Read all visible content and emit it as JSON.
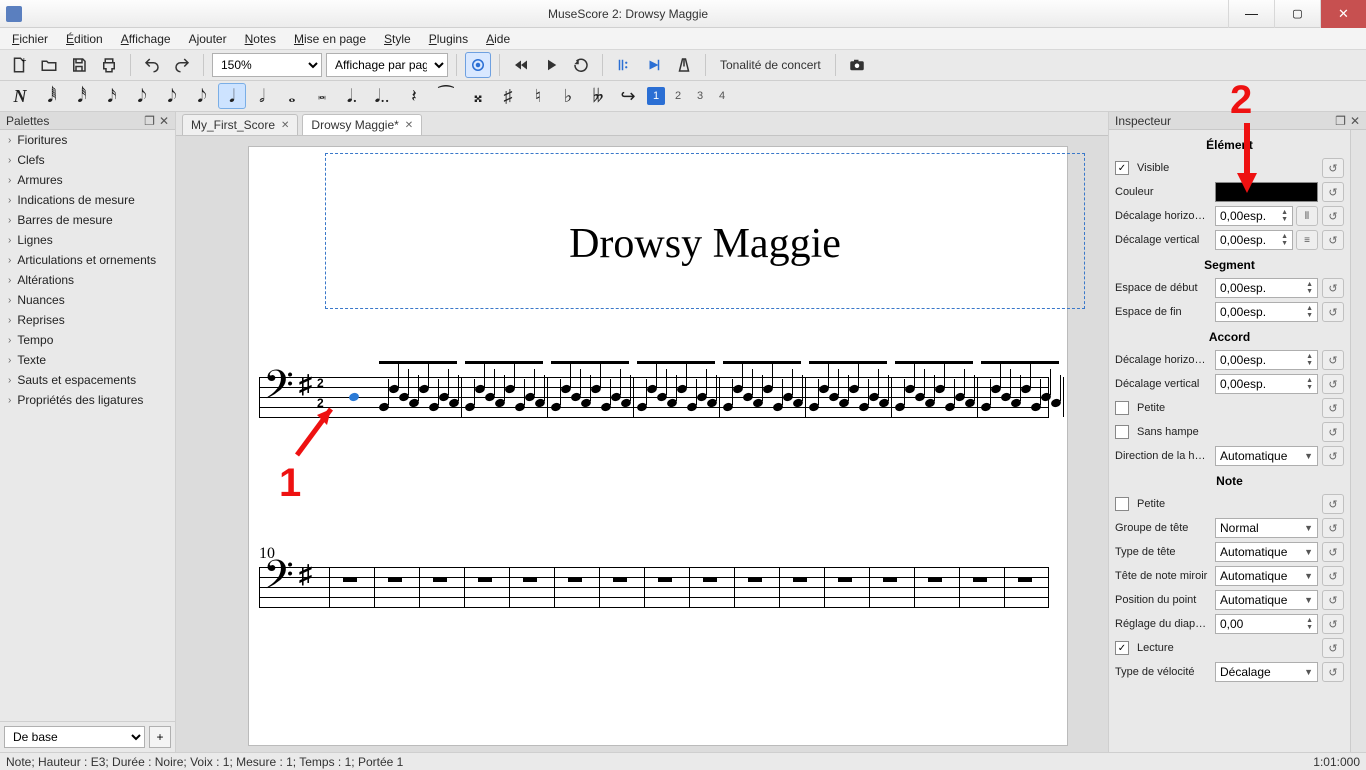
{
  "window": {
    "title": "MuseScore 2: Drowsy Maggie"
  },
  "menu": [
    "Fichier",
    "Édition",
    "Affichage",
    "Ajouter",
    "Notes",
    "Mise en page",
    "Style",
    "Plugins",
    "Aide"
  ],
  "toolbar1": {
    "zoom": "150%",
    "viewmode": "Affichage par page",
    "concert": "Tonalité de concert"
  },
  "voices": [
    "1",
    "2",
    "3",
    "4"
  ],
  "palettes": {
    "title": "Palettes",
    "items": [
      "Fioritures",
      "Clefs",
      "Armures",
      "Indications de mesure",
      "Barres de mesure",
      "Lignes",
      "Articulations et ornements",
      "Altérations",
      "Nuances",
      "Reprises",
      "Tempo",
      "Texte",
      "Sauts et espacements",
      "Propriétés des ligatures"
    ],
    "base": "De base",
    "add": "+"
  },
  "tabs": [
    {
      "label": "My_First_Score",
      "modified": false,
      "active": false
    },
    {
      "label": "Drowsy Maggie*",
      "modified": true,
      "active": true
    }
  ],
  "score": {
    "title": "Drowsy Maggie",
    "measure_number": "10",
    "timesig_top": "2",
    "timesig_bot": "2",
    "keysig": "♯"
  },
  "inspector": {
    "title": "Inspecteur",
    "sections": {
      "element": "Élément",
      "segment": "Segment",
      "chord": "Accord",
      "note": "Note"
    },
    "labels": {
      "visible": "Visible",
      "couleur": "Couleur",
      "dech": "Décalage horizontal",
      "decv": "Décalage vertical",
      "espdeb": "Espace de début",
      "espfin": "Espace de fin",
      "petite": "Petite",
      "sanshampe": "Sans hampe",
      "dirhampe": "Direction de la hampe",
      "grptete": "Groupe de tête",
      "typetete": "Type de tête",
      "tetemir": "Tête de note miroir",
      "pospoint": "Position du point",
      "diapason": "Réglage du diapason",
      "lecture": "Lecture",
      "typevel": "Type de vélocité"
    },
    "values": {
      "esp": "0,00esp.",
      "zero": "0,00",
      "auto": "Automatique",
      "normal": "Normal",
      "decalage": "Décalage"
    }
  },
  "status": {
    "left": "Note; Hauteur : E3; Durée : Noire; Voix : 1;  Mesure : 1; Temps : 1; Portée 1",
    "right": "1:01:000"
  },
  "annotations": {
    "one": "1",
    "two": "2"
  }
}
